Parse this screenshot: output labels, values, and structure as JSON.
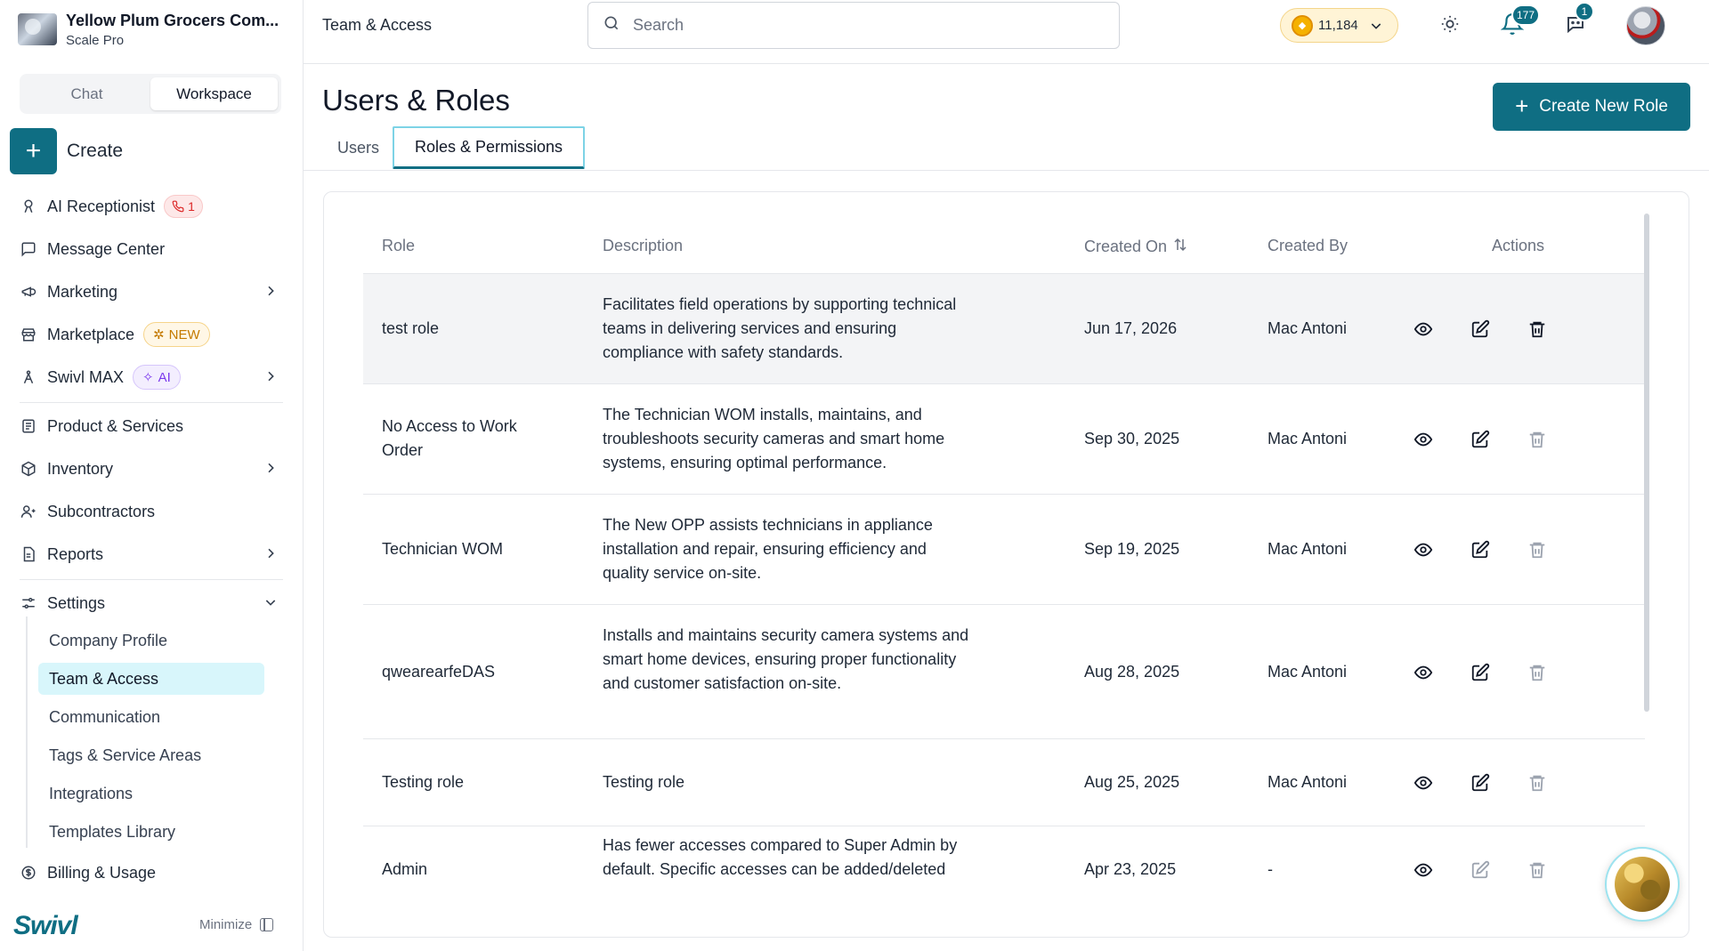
{
  "sidebar": {
    "org_name": "Yellow Plum Grocers Com...",
    "org_plan": "Scale Pro",
    "segments": [
      "Chat",
      "Workspace"
    ],
    "create_label": "Create",
    "items": {
      "ai_receptionist": "AI Receptionist",
      "ai_receptionist_count": "1",
      "message_center": "Message Center",
      "marketing": "Marketing",
      "marketplace": "Marketplace",
      "marketplace_badge": "NEW",
      "swivl_max": "Swivl MAX",
      "swivl_max_badge": "AI",
      "product_services": "Product & Services",
      "inventory": "Inventory",
      "subcontractors": "Subcontractors",
      "reports": "Reports",
      "settings": "Settings",
      "billing_usage": "Billing & Usage"
    },
    "settings_sub": [
      "Company Profile",
      "Team & Access",
      "Communication",
      "Tags & Service Areas",
      "Integrations",
      "Templates Library"
    ],
    "brand": "Swivl",
    "minimize": "Minimize"
  },
  "topbar": {
    "breadcrumb": "Team & Access",
    "search_placeholder": "Search",
    "coins": "11,184",
    "notifications_count": "177",
    "messages_count": "1"
  },
  "main": {
    "title": "Users & Roles",
    "create_button": "Create New Role",
    "tabs": [
      "Users",
      "Roles & Permissions"
    ],
    "active_tab": "Roles & Permissions",
    "columns": [
      "Role",
      "Description",
      "Created On",
      "Created By",
      "Actions"
    ],
    "rows": [
      {
        "role": "test role",
        "description": "Facilitates field operations by supporting technical teams in delivering services and ensuring compliance with safety standards.",
        "created_on": "Jun 17, 2026",
        "created_by": "Mac Antoni"
      },
      {
        "role": "No Access to Work Order",
        "description": "The Technician WOM installs, maintains, and troubleshoots security cameras and smart home systems, ensuring optimal performance.",
        "created_on": "Sep 30, 2025",
        "created_by": "Mac Antoni"
      },
      {
        "role": "Technician WOM",
        "description": "The New OPP assists technicians in appliance installation and repair, ensuring efficiency and quality service on-site.",
        "created_on": "Sep 19, 2025",
        "created_by": "Mac Antoni"
      },
      {
        "role": "qwearearfeDAS",
        "description": "Installs and maintains security camera systems and smart home devices, ensuring proper functionality and customer satisfaction on-site.",
        "created_on": "Aug 28, 2025",
        "created_by": "Mac Antoni"
      },
      {
        "role": "Testing role",
        "description": "Testing role",
        "created_on": "Aug 25, 2025",
        "created_by": "Mac Antoni"
      },
      {
        "role": "Admin",
        "description": "Has fewer accesses compared to Super Admin by default. Specific accesses can be added/deleted",
        "created_on": "Apr 23, 2025",
        "created_by": "-"
      }
    ]
  },
  "colors": {
    "accent": "#0f6e83",
    "active_nav_bg": "#d8f6fb",
    "row_highlight": "#f3f4f6",
    "delete_active": "#111827",
    "delete_disabled": "#9ca3af"
  }
}
